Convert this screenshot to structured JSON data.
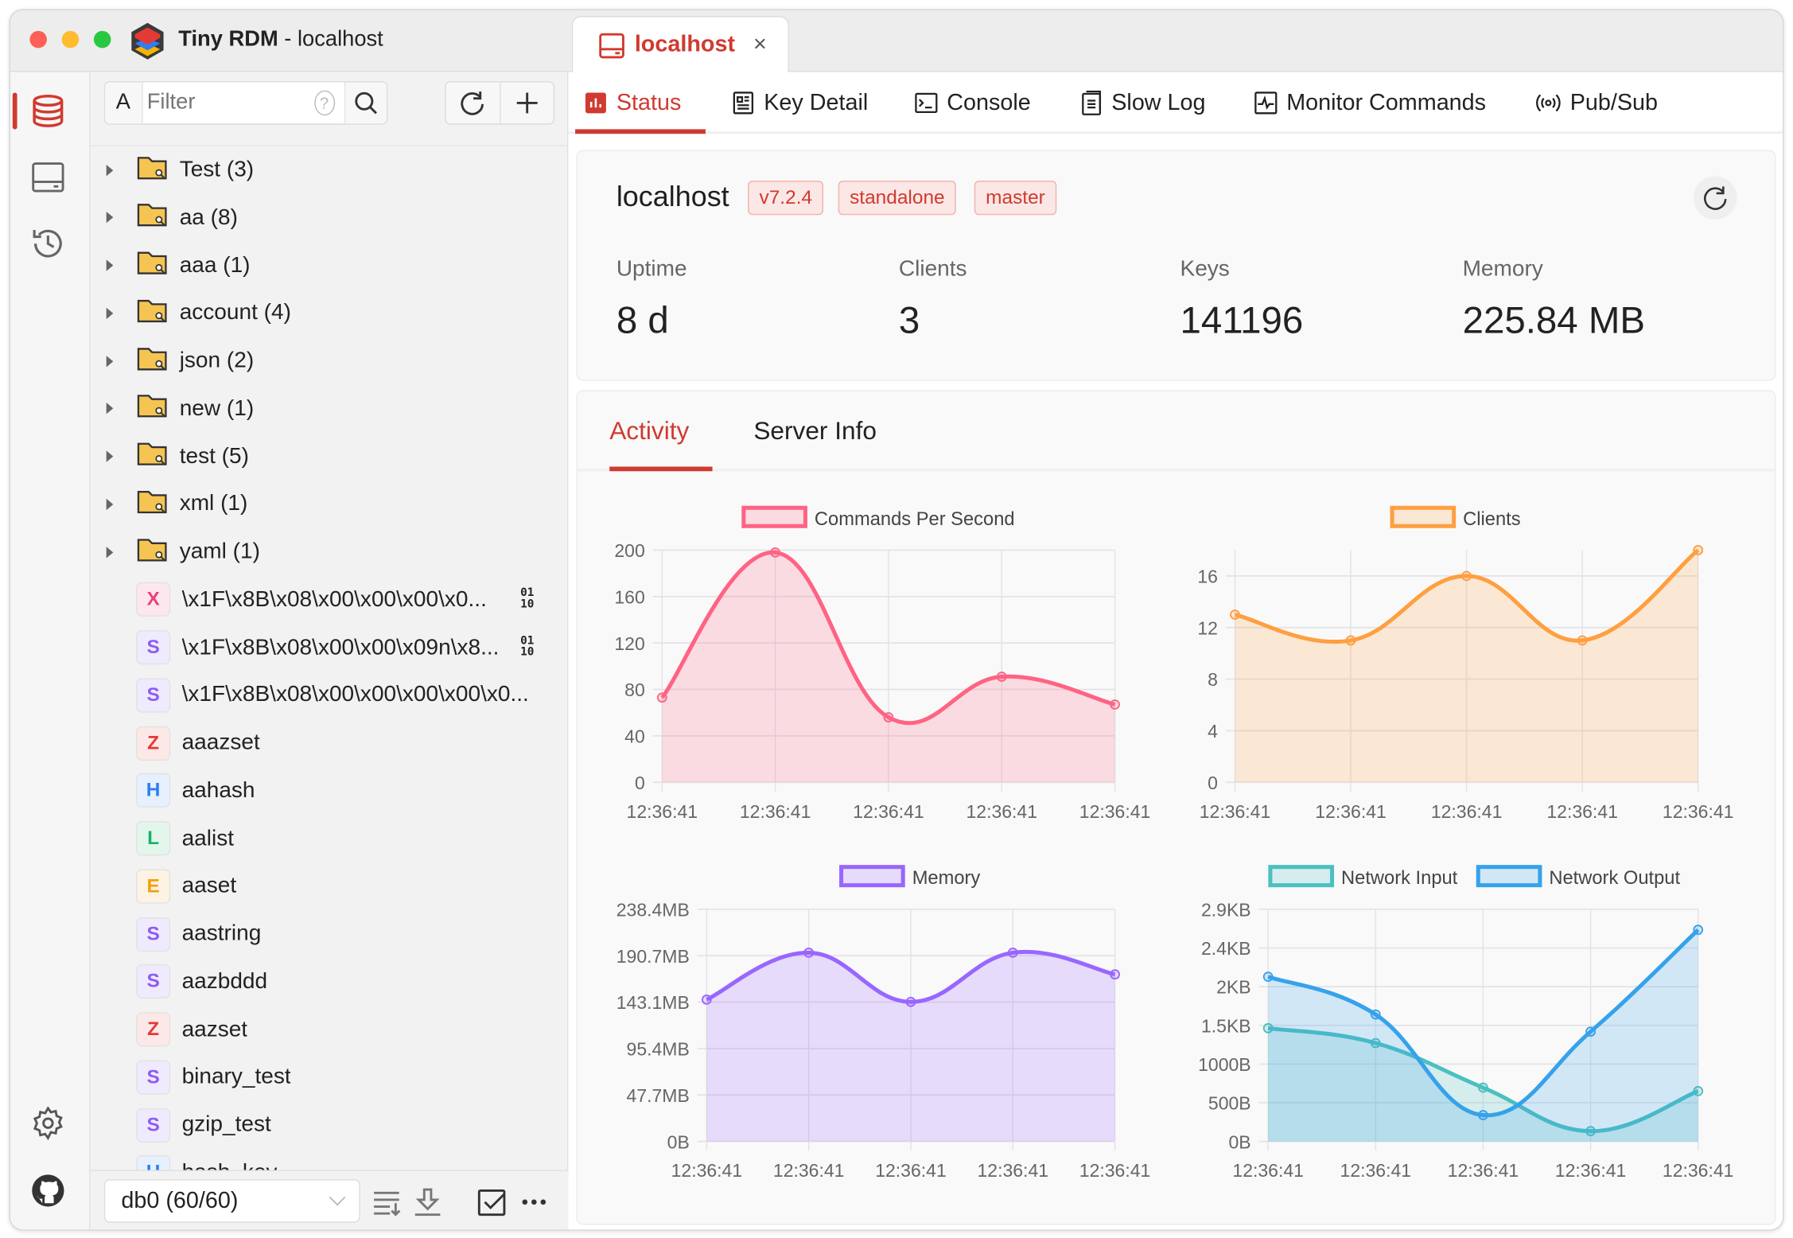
{
  "window": {
    "app_name": "Tiny RDM",
    "subtitle": "- localhost"
  },
  "connection_tab": {
    "label": "localhost",
    "close": "×"
  },
  "iconbar": {
    "items": [
      "database-icon",
      "server-icon",
      "history-icon"
    ],
    "bottom": [
      "settings-icon",
      "github-icon"
    ]
  },
  "sidebar": {
    "filter": {
      "mode": "A",
      "placeholder": "Filter",
      "value": ""
    },
    "folders": [
      {
        "label": "Test (3)"
      },
      {
        "label": "aa (8)"
      },
      {
        "label": "aaa (1)"
      },
      {
        "label": "account (4)"
      },
      {
        "label": "json (2)"
      },
      {
        "label": "new (1)"
      },
      {
        "label": "test (5)"
      },
      {
        "label": "xml (1)"
      },
      {
        "label": "yaml (1)"
      }
    ],
    "keys": [
      {
        "type": "X",
        "name": "\\x1F\\x8B\\x08\\x00\\x00\\x00\\x0...",
        "binary": true,
        "bin_top": "01",
        "bin_bottom": "10"
      },
      {
        "type": "S",
        "name": "\\x1F\\x8B\\x08\\x00\\x00\\x09n\\x8...",
        "binary": true,
        "bin_top": "01",
        "bin_bottom": "10"
      },
      {
        "type": "S",
        "name": "\\x1F\\x8B\\x08\\x00\\x00\\x00\\x00\\x0..."
      },
      {
        "type": "Z",
        "name": "aaazset"
      },
      {
        "type": "H",
        "name": "aahash"
      },
      {
        "type": "L",
        "name": "aalist"
      },
      {
        "type": "E",
        "name": "aaset"
      },
      {
        "type": "S",
        "name": "aastring"
      },
      {
        "type": "S",
        "name": "aazbddd"
      },
      {
        "type": "Z",
        "name": "aazset"
      },
      {
        "type": "S",
        "name": "binary_test"
      },
      {
        "type": "S",
        "name": "gzip_test"
      },
      {
        "type": "H",
        "name": "hash_key"
      }
    ],
    "type_colors": {
      "X": {
        "fg": "#ec407a",
        "bg": "#fde7ee"
      },
      "S": {
        "fg": "#8b5cf6",
        "bg": "#efeafd"
      },
      "Z": {
        "fg": "#e53935",
        "bg": "#fde8e8"
      },
      "H": {
        "fg": "#2f7df6",
        "bg": "#e6f0fe"
      },
      "L": {
        "fg": "#17b26a",
        "bg": "#e3f6ec"
      },
      "E": {
        "fg": "#f59e0b",
        "bg": "#fef3e2"
      }
    },
    "db_select": "db0 (60/60)"
  },
  "nav_tabs": [
    {
      "label": "Status",
      "icon": "status-icon",
      "active": true
    },
    {
      "label": "Key Detail",
      "icon": "key-detail-icon"
    },
    {
      "label": "Console",
      "icon": "console-icon"
    },
    {
      "label": "Slow Log",
      "icon": "slow-log-icon"
    },
    {
      "label": "Monitor Commands",
      "icon": "monitor-icon"
    },
    {
      "label": "Pub/Sub",
      "icon": "pubsub-icon"
    }
  ],
  "server": {
    "name": "localhost",
    "tags": [
      "v7.2.4",
      "standalone",
      "master"
    ],
    "stats": [
      {
        "label": "Uptime",
        "value": "8 d"
      },
      {
        "label": "Clients",
        "value": "3"
      },
      {
        "label": "Keys",
        "value": "141196"
      },
      {
        "label": "Memory",
        "value": "225.84 MB"
      }
    ]
  },
  "activity_tabs": [
    {
      "label": "Activity",
      "active": true
    },
    {
      "label": "Server Info"
    }
  ],
  "accent": "#d03a2f",
  "chart_data": [
    {
      "type": "area",
      "categories": [
        "12:36:41",
        "12:36:41",
        "12:36:41",
        "12:36:41",
        "12:36:41"
      ],
      "series": [
        {
          "name": "Commands Per Second",
          "values": [
            73,
            198,
            56,
            91,
            67
          ],
          "color": "#ff6384",
          "fill": "rgba(255,99,132,0.2)"
        }
      ],
      "ylim": [
        0,
        200
      ],
      "yticks": [
        0,
        40,
        80,
        120,
        160,
        200
      ],
      "ytick_labels": [
        "0",
        "40",
        "80",
        "120",
        "160",
        "200"
      ],
      "grid": true,
      "legend": "top"
    },
    {
      "type": "area",
      "categories": [
        "12:36:41",
        "12:36:41",
        "12:36:41",
        "12:36:41",
        "12:36:41"
      ],
      "series": [
        {
          "name": "Clients",
          "values": [
            13,
            11,
            16,
            11,
            18
          ],
          "color": "#ff9f40",
          "fill": "rgba(255,159,64,0.2)"
        }
      ],
      "ylim": [
        0,
        18
      ],
      "yticks": [
        0,
        4,
        8,
        12,
        16
      ],
      "ytick_labels": [
        "0",
        "4",
        "8",
        "12",
        "16"
      ],
      "grid": true,
      "legend": "top"
    },
    {
      "type": "area",
      "categories": [
        "12:36:41",
        "12:36:41",
        "12:36:41",
        "12:36:41",
        "12:36:41"
      ],
      "series": [
        {
          "name": "Memory",
          "values": [
            145.6,
            193.8,
            143.3,
            193.8,
            171.5
          ],
          "color": "#9966ff",
          "fill": "rgba(153,102,255,0.2)"
        }
      ],
      "unit": "MB",
      "ylim": [
        0,
        238.4
      ],
      "yticks": [
        0,
        47.7,
        95.4,
        143.1,
        190.7,
        238.4
      ],
      "ytick_labels": [
        "0B",
        "47.7MB",
        "95.4MB",
        "143.1MB",
        "190.7MB",
        "238.4MB"
      ],
      "grid": true,
      "legend": "top"
    },
    {
      "type": "area",
      "categories": [
        "12:36:41",
        "12:36:41",
        "12:36:41",
        "12:36:41",
        "12:36:41"
      ],
      "series": [
        {
          "name": "Network Input",
          "values": [
            1463,
            1271,
            695,
            133,
            650
          ],
          "color": "#4bc0c0",
          "fill": "rgba(75,192,192,0.2)"
        },
        {
          "name": "Network Output",
          "values": [
            2128,
            1640,
            340,
            1419,
            2734
          ],
          "color": "#36a2eb",
          "fill": "rgba(54,162,235,0.2)"
        }
      ],
      "unit": "B",
      "ylim": [
        0,
        3000
      ],
      "yticks": [
        0,
        500,
        1000,
        1500,
        2000,
        2500,
        3000
      ],
      "ytick_labels": [
        "0B",
        "500B",
        "1000B",
        "1.5KB",
        "2KB",
        "2.4KB",
        "2.9KB"
      ],
      "grid": true,
      "legend": "top"
    }
  ]
}
